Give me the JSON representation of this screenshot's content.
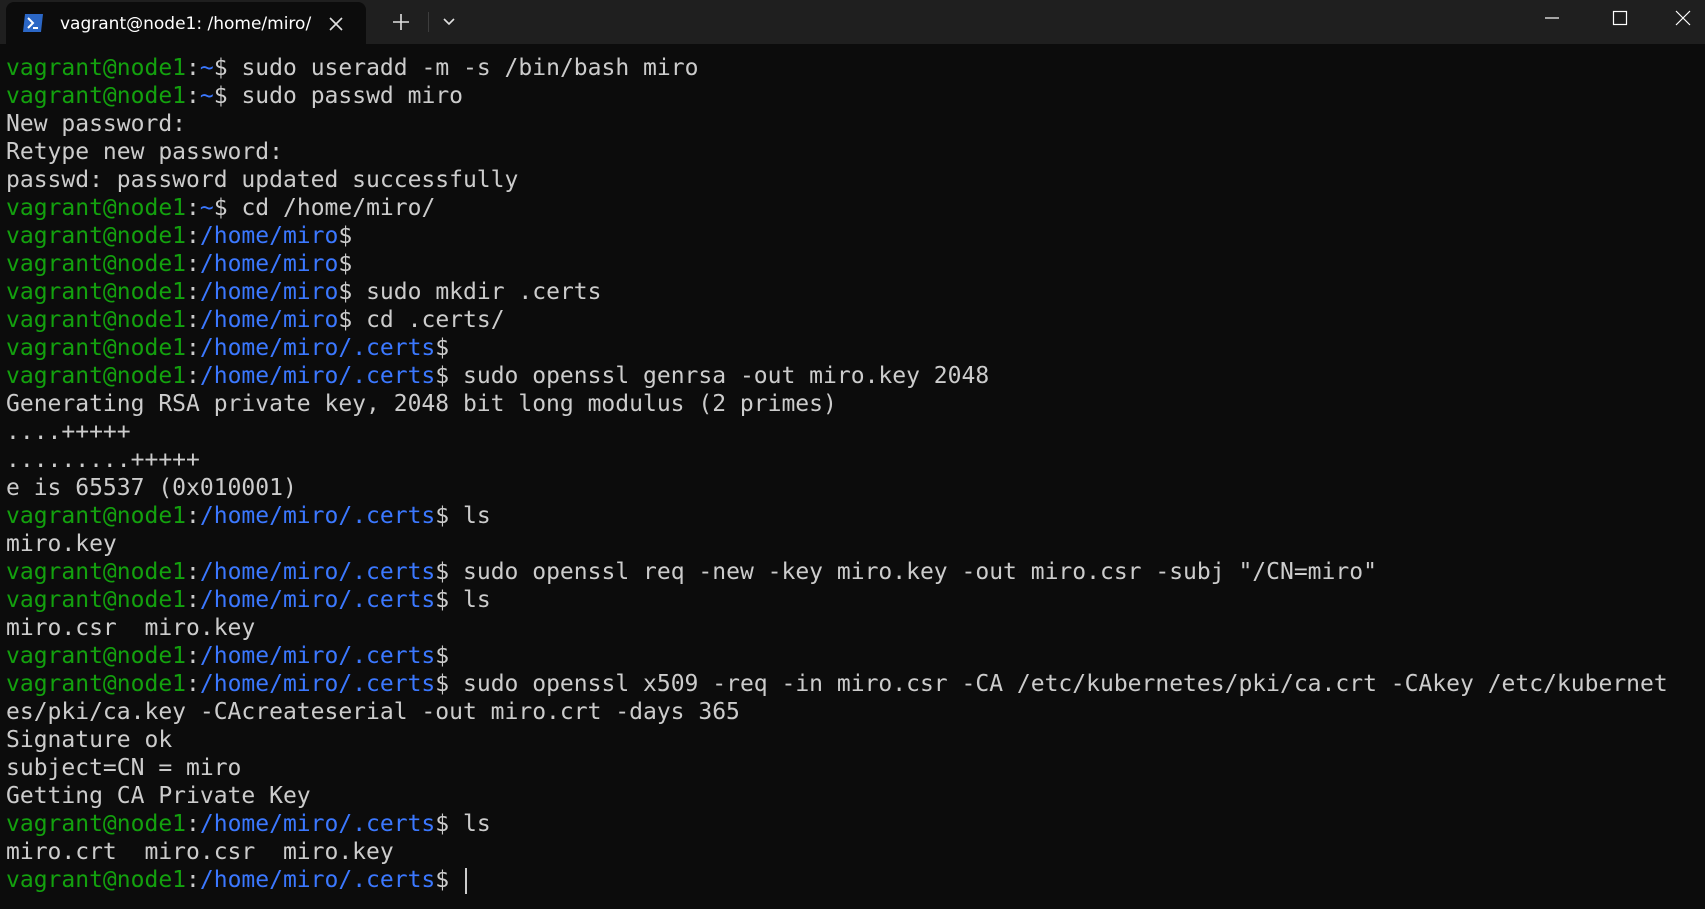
{
  "window": {
    "tab_title": "vagrant@node1: /home/miro/",
    "new_tab_symbol": "+",
    "icons": {
      "tab": "powershell-icon",
      "close_tab": "close-icon",
      "new_tab": "plus-icon",
      "dropdown": "chevron-down-icon",
      "minimize": "minimize-icon",
      "maximize": "maximize-icon",
      "close_window": "close-icon"
    }
  },
  "colors": {
    "background": "#0c0c0c",
    "titlebar": "#1f1f1f",
    "user_host": "#13a10e",
    "path": "#3b78ff",
    "text": "#cccccc"
  },
  "terminal": {
    "lines": [
      {
        "type": "prompt",
        "user": "vagrant@node1",
        "path": "~",
        "cmd": "sudo useradd -m -s /bin/bash miro"
      },
      {
        "type": "prompt",
        "user": "vagrant@node1",
        "path": "~",
        "cmd": "sudo passwd miro"
      },
      {
        "type": "output",
        "text": "New password:"
      },
      {
        "type": "output",
        "text": "Retype new password:"
      },
      {
        "type": "output",
        "text": "passwd: password updated successfully"
      },
      {
        "type": "prompt",
        "user": "vagrant@node1",
        "path": "~",
        "cmd": "cd /home/miro/"
      },
      {
        "type": "prompt",
        "user": "vagrant@node1",
        "path": "/home/miro",
        "cmd": ""
      },
      {
        "type": "prompt",
        "user": "vagrant@node1",
        "path": "/home/miro",
        "cmd": ""
      },
      {
        "type": "prompt",
        "user": "vagrant@node1",
        "path": "/home/miro",
        "cmd": "sudo mkdir .certs"
      },
      {
        "type": "prompt",
        "user": "vagrant@node1",
        "path": "/home/miro",
        "cmd": "cd .certs/"
      },
      {
        "type": "prompt",
        "user": "vagrant@node1",
        "path": "/home/miro/.certs",
        "cmd": ""
      },
      {
        "type": "prompt",
        "user": "vagrant@node1",
        "path": "/home/miro/.certs",
        "cmd": "sudo openssl genrsa -out miro.key 2048"
      },
      {
        "type": "output",
        "text": "Generating RSA private key, 2048 bit long modulus (2 primes)"
      },
      {
        "type": "output",
        "text": "....+++++"
      },
      {
        "type": "output",
        "text": ".........+++++"
      },
      {
        "type": "output",
        "text": "e is 65537 (0x010001)"
      },
      {
        "type": "prompt",
        "user": "vagrant@node1",
        "path": "/home/miro/.certs",
        "cmd": "ls"
      },
      {
        "type": "output",
        "text": "miro.key"
      },
      {
        "type": "prompt",
        "user": "vagrant@node1",
        "path": "/home/miro/.certs",
        "cmd": "sudo openssl req -new -key miro.key -out miro.csr -subj \"/CN=miro\""
      },
      {
        "type": "prompt",
        "user": "vagrant@node1",
        "path": "/home/miro/.certs",
        "cmd": "ls"
      },
      {
        "type": "output",
        "text": "miro.csr  miro.key"
      },
      {
        "type": "prompt",
        "user": "vagrant@node1",
        "path": "/home/miro/.certs",
        "cmd": ""
      },
      {
        "type": "prompt",
        "user": "vagrant@node1",
        "path": "/home/miro/.certs",
        "cmd": "sudo openssl x509 -req -in miro.csr -CA /etc/kubernetes/pki/ca.crt -CAkey /etc/kubernet"
      },
      {
        "type": "output",
        "text": "es/pki/ca.key -CAcreateserial -out miro.crt -days 365"
      },
      {
        "type": "output",
        "text": "Signature ok"
      },
      {
        "type": "output",
        "text": "subject=CN = miro"
      },
      {
        "type": "output",
        "text": "Getting CA Private Key"
      },
      {
        "type": "prompt",
        "user": "vagrant@node1",
        "path": "/home/miro/.certs",
        "cmd": "ls"
      },
      {
        "type": "output",
        "text": "miro.crt  miro.csr  miro.key"
      },
      {
        "type": "prompt",
        "user": "vagrant@node1",
        "path": "/home/miro/.certs",
        "cmd": "",
        "cursor": true
      }
    ]
  }
}
